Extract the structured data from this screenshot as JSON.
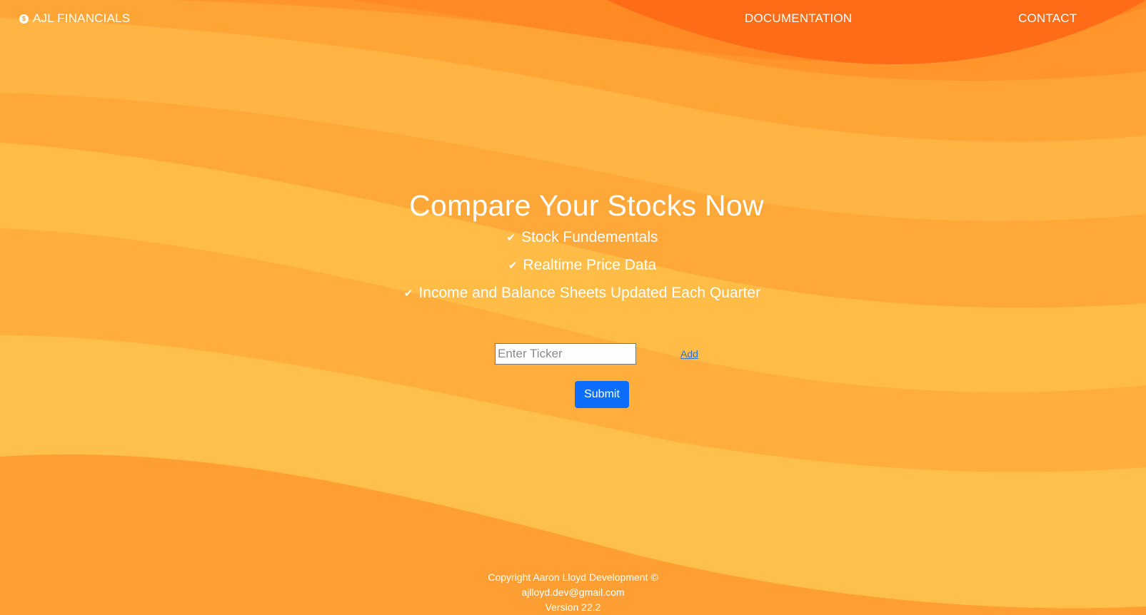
{
  "nav": {
    "brand_icon": "dollar-coin-icon",
    "brand_icon_glyph": "$",
    "brand_label": "AJL FINANCIALS",
    "documentation_label": "DOCUMENTATION",
    "contact_label": "CONTACT"
  },
  "hero": {
    "title": "Compare Your Stocks Now",
    "check_icon": "check-icon",
    "check_glyph": "✔",
    "features": [
      "Stock Fundementals",
      "Realtime Price Data",
      "Income and Balance Sheets Updated Each Quarter"
    ]
  },
  "form": {
    "ticker_placeholder": "Enter Ticker",
    "ticker_value": "",
    "add_label": "Add",
    "submit_label": "Submit"
  },
  "footer": {
    "copyright": "Copyright Aaron Lloyd Development ©",
    "email": "ajlloyd.dev@gmail.com",
    "version": "Version 22.2"
  },
  "colors": {
    "background_light": "#ffbf4a",
    "background_mid": "#ffa43a",
    "background_dark": "#ff6b17",
    "submit_button": "#0d6efd",
    "add_link": "#2d6fd6",
    "text": "#ffffff"
  }
}
